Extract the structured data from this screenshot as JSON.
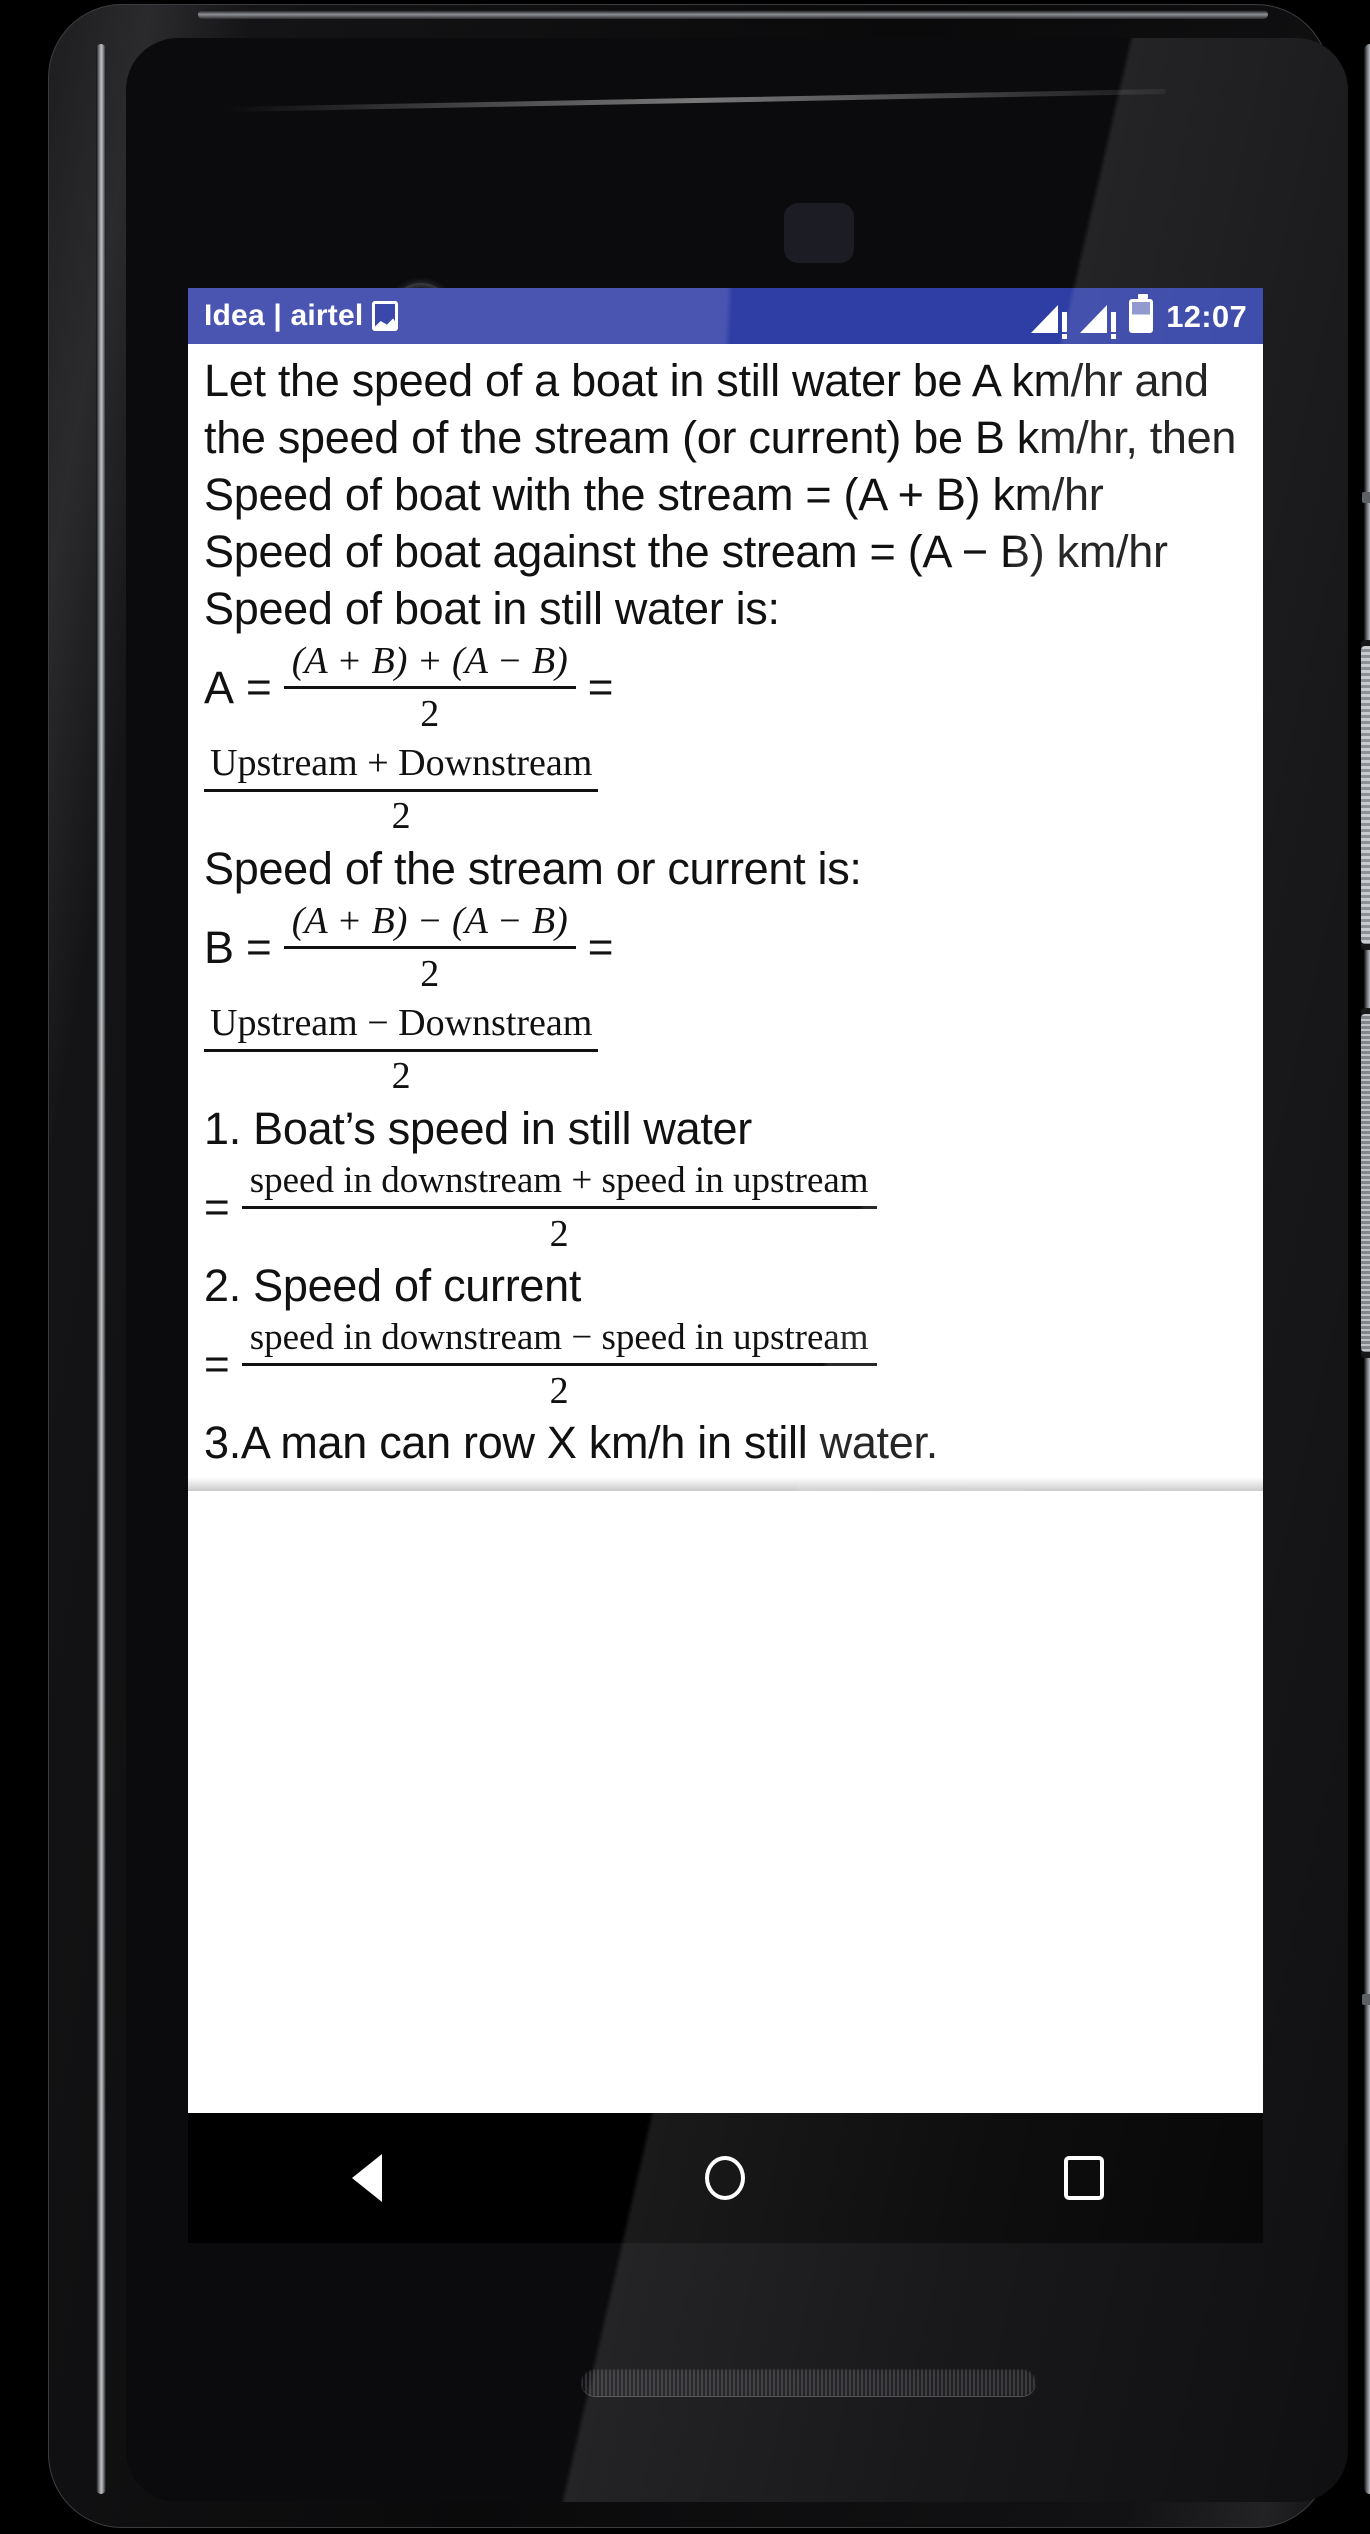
{
  "device": {
    "type": "android-phone",
    "hardware": {
      "front_camera": "front-camera",
      "earpiece": "earpiece-speaker",
      "bottom_speaker": "bottom-speaker",
      "power_button": "power-button",
      "volume_button": "volume-rocker"
    }
  },
  "status_bar": {
    "carrier": "Idea | airtel",
    "screenshot_icon": "screenshot-icon",
    "signal_icon_1": "signal-no-service-icon",
    "signal_icon_2": "signal-no-service-icon",
    "battery_icon": "battery-half-icon",
    "clock": "12:07",
    "background_left": "#4a55b2",
    "background_right": "#2f3ea4",
    "text_color": "#ffffff"
  },
  "content": {
    "paragraphs": [
      "Let the speed of a boat in still water be A km/hr and the speed of the stream (or current) be B km/hr, then",
      "Speed of boat with the stream = (A + B) km/hr",
      "Speed of boat against the stream = (A − B) km/hr",
      "Speed of boat in still water is:"
    ],
    "formula_a": {
      "lead": "A",
      "equals_1": "=",
      "numerator": "(A + B) + (A − B)",
      "denominator": "2",
      "equals_2": "=",
      "second_numerator": "Upstream  + Downstream",
      "second_denominator": "2"
    },
    "stream_heading": "Speed of the stream or current is:",
    "formula_b": {
      "lead": "B",
      "equals_1": "=",
      "numerator": "(A + B) − (A − B)",
      "denominator": "2",
      "equals_2": "=",
      "second_numerator": "Upstream  − Downstream",
      "second_denominator": "2"
    },
    "item_1": {
      "heading": "1. Boat’s speed in still water",
      "equals": "=",
      "numerator": "speed in downstream  + speed in upstream",
      "denominator": "2"
    },
    "item_2": {
      "heading": "2. Speed of current",
      "equals": "=",
      "numerator": "speed in downstream  − speed in upstream",
      "denominator": "2"
    },
    "item_3": "3.A man can row X km/h in still water."
  },
  "nav_bar": {
    "back": "back-icon",
    "home": "home-icon",
    "recents": "recents-icon"
  }
}
